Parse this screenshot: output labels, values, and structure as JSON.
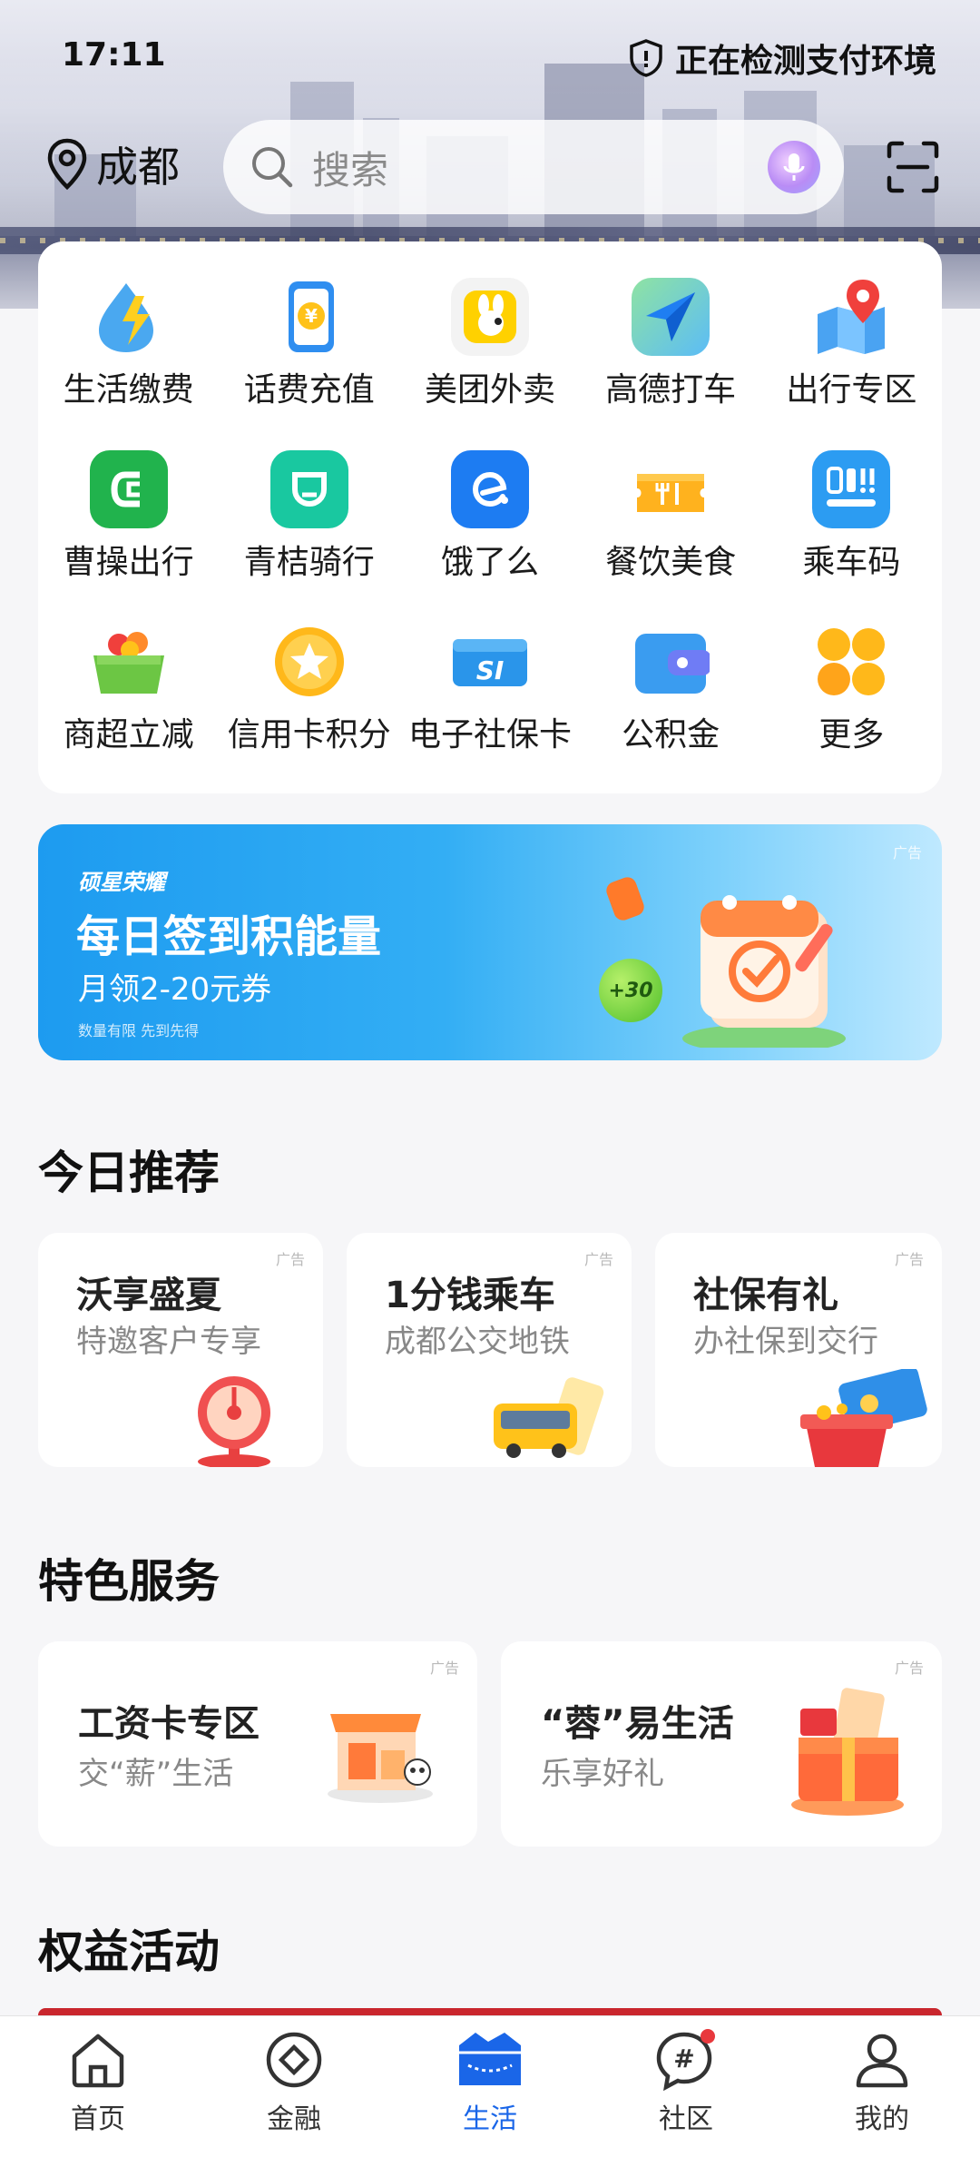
{
  "status": {
    "time": "17:11",
    "security_text": "正在检测支付环境"
  },
  "topbar": {
    "city": "成都",
    "search_placeholder": "搜索"
  },
  "services": [
    {
      "label": "生活缴费",
      "icon": "life-payment-icon"
    },
    {
      "label": "话费充值",
      "icon": "phone-recharge-icon"
    },
    {
      "label": "美团外卖",
      "icon": "meituan-icon"
    },
    {
      "label": "高德打车",
      "icon": "gaode-taxi-icon"
    },
    {
      "label": "出行专区",
      "icon": "travel-map-icon"
    },
    {
      "label": "曹操出行",
      "icon": "caocao-icon"
    },
    {
      "label": "青桔骑行",
      "icon": "qingju-bike-icon"
    },
    {
      "label": "饿了么",
      "icon": "eleme-icon"
    },
    {
      "label": "餐饮美食",
      "icon": "dining-icon"
    },
    {
      "label": "乘车码",
      "icon": "bus-code-icon"
    },
    {
      "label": "商超立减",
      "icon": "supermarket-basket-icon"
    },
    {
      "label": "信用卡积分",
      "icon": "credit-points-icon"
    },
    {
      "label": "电子社保卡",
      "icon": "social-security-card-icon"
    },
    {
      "label": "公积金",
      "icon": "wallet-icon"
    },
    {
      "label": "更多",
      "icon": "more-grid-icon"
    }
  ],
  "banner": {
    "brand": "硕星荣耀",
    "title": "每日签到积能量",
    "subtitle": "月领2-20元券",
    "note": "数量有限 先到先得",
    "badge": "+30",
    "ad": "广告"
  },
  "sections": {
    "today": "今日推荐",
    "featured": "特色服务",
    "rights": "权益活动"
  },
  "today_cards": [
    {
      "title": "沃享盛夏",
      "subtitle": "特邀客户专享",
      "ad": "广告"
    },
    {
      "title": "1分钱乘车",
      "subtitle": "成都公交地铁",
      "ad": "广告"
    },
    {
      "title": "社保有礼",
      "subtitle": "办社保到交行",
      "ad": "广告"
    }
  ],
  "featured_cards": [
    {
      "title": "工资卡专区",
      "subtitle": "交“薪”生活",
      "ad": "广告"
    },
    {
      "title": "“蓉”易生活",
      "subtitle": "乐享好礼",
      "ad": "广告"
    }
  ],
  "tabs": [
    {
      "label": "首页"
    },
    {
      "label": "金融"
    },
    {
      "label": "生活"
    },
    {
      "label": "社区"
    },
    {
      "label": "我的"
    }
  ],
  "colors": {
    "accent": "#1a66e8",
    "badge": "#e8383d",
    "banner": "#1d9bf0"
  }
}
